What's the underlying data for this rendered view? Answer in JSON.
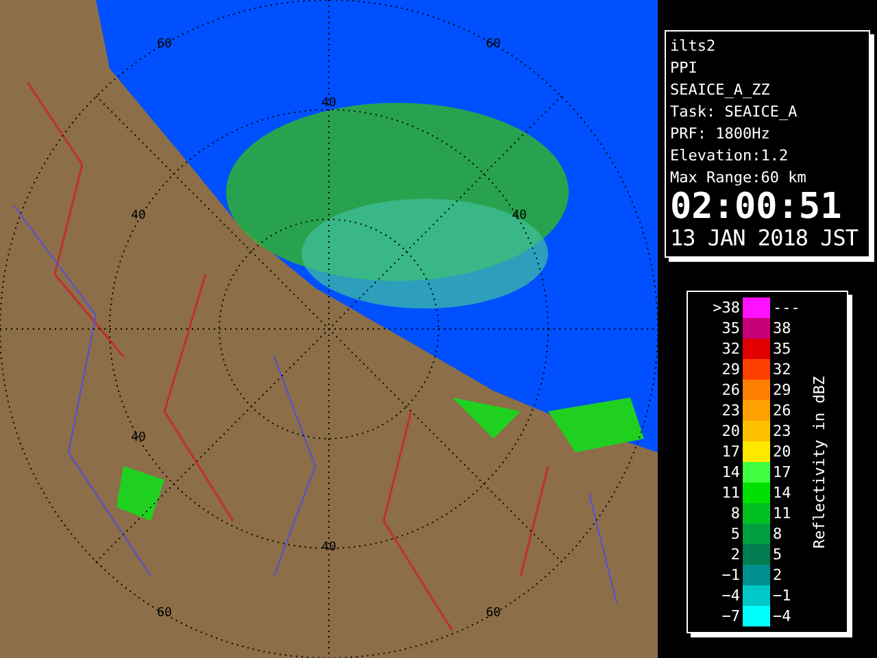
{
  "map": {
    "ring_labels": [
      "60",
      "60",
      "40",
      "40",
      "40",
      "40",
      "40",
      "60",
      "60"
    ]
  },
  "info": {
    "lines": [
      "ilts2",
      "PPI",
      "SEAICE_A_ZZ",
      "Task: SEAICE_A",
      "PRF: 1800Hz",
      "Elevation:1.2",
      "Max Range:60 km"
    ],
    "time": "02:00:51",
    "date": "13 JAN 2018 JST"
  },
  "legend": {
    "title": "Reflectivity in dBZ",
    "rows": [
      {
        "low": ">38",
        "high": "---",
        "color": "#ff10ff"
      },
      {
        "low": "35",
        "high": "38",
        "color": "#c8007a"
      },
      {
        "low": "32",
        "high": "35",
        "color": "#e00000"
      },
      {
        "low": "29",
        "high": "32",
        "color": "#ff4000"
      },
      {
        "low": "26",
        "high": "29",
        "color": "#ff8000"
      },
      {
        "low": "23",
        "high": "26",
        "color": "#ffa000"
      },
      {
        "low": "20",
        "high": "23",
        "color": "#ffc000"
      },
      {
        "low": "17",
        "high": "20",
        "color": "#ffe800"
      },
      {
        "low": "14",
        "high": "17",
        "color": "#40ff40"
      },
      {
        "low": "11",
        "high": "14",
        "color": "#00e000"
      },
      {
        "low": "8",
        "high": "11",
        "color": "#00c020"
      },
      {
        "low": "5",
        "high": "8",
        "color": "#00a040"
      },
      {
        "low": "2",
        "high": "5",
        "color": "#007c50"
      },
      {
        "low": "−1",
        "high": "2",
        "color": "#009090"
      },
      {
        "low": "−4",
        "high": "−1",
        "color": "#00c8c8"
      },
      {
        "low": "−7",
        "high": "−4",
        "color": "#00ffff"
      }
    ]
  }
}
